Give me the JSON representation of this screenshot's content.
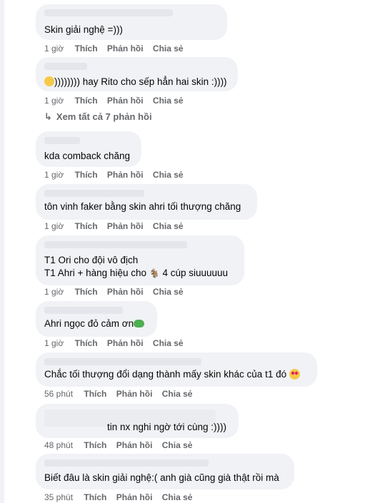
{
  "actions": {
    "like": "Thích",
    "reply": "Phản hồi",
    "share": "Chia sẻ"
  },
  "view_more": {
    "label": "Xem tất cả 7 phản hồi"
  },
  "comments": [
    {
      "text": "Skin giải nghệ =)))",
      "time": "1 giờ"
    },
    {
      "text": ")))))))) hay Rito cho sếp hẳn hai skin :))))",
      "time": "1 giờ"
    },
    {
      "text": "kda comback chăng",
      "time": "1 giờ"
    },
    {
      "text": "tôn vinh faker bằng skin ahri tối thượng chăng",
      "time": "1 giờ"
    },
    {
      "line1": "T1 Ori cho đội vô địch",
      "line2a": "T1 Ahri + hàng hiệu cho",
      "line2b": "4 cúp siuuuuuu",
      "time": "1 giờ"
    },
    {
      "text": "Ahri ngọc đỏ cảm ơn",
      "time": "1 giờ"
    },
    {
      "text": "Chắc tối thượng đổi dạng thành mấy skin khác của t1 đó",
      "time": "56 phút"
    },
    {
      "text": "tin nx nghi ngờ tới cùng :))))",
      "time": "48 phút"
    },
    {
      "text": "Biết đâu là skin giải nghệ:( anh già cũng già thật rồi mà",
      "time": "35 phút"
    }
  ]
}
